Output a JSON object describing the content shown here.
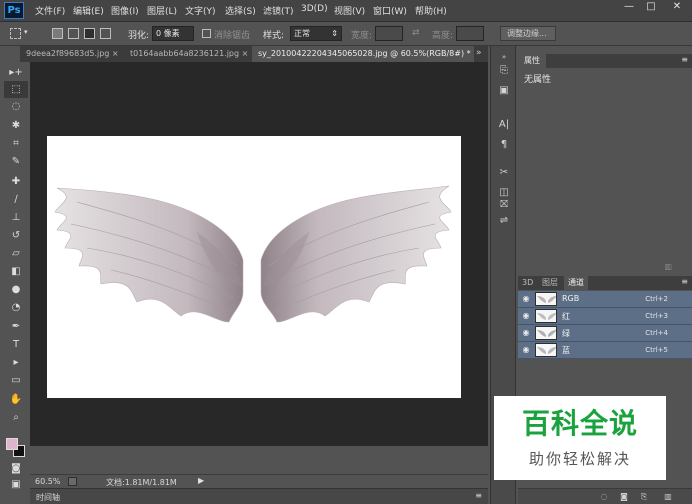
{
  "app": {
    "logo": "Ps"
  },
  "menu": [
    "文件(F)",
    "编辑(E)",
    "图像(I)",
    "图层(L)",
    "文字(Y)",
    "选择(S)",
    "滤镜(T)",
    "3D(D)",
    "视图(V)",
    "窗口(W)",
    "帮助(H)"
  ],
  "window_controls": {
    "minimize": "—",
    "maximize": "□",
    "close": "✕"
  },
  "options": {
    "feather_label": "羽化:",
    "feather_value": "0 像素",
    "antialias_label": "消除锯齿",
    "style_label": "样式:",
    "style_value": "正常",
    "width_label": "宽度:",
    "height_label": "高度:",
    "refine_button": "调整边缘..."
  },
  "tabs": [
    {
      "label": "9deea2f89683d5.jpg",
      "close": "×"
    },
    {
      "label": "t0164aabb64a8236121.jpg",
      "close": "×"
    },
    {
      "label": "sy_20100422204345065028.jpg @ 60.5%(RGB/8#) *",
      "close": "×"
    }
  ],
  "tab_overflow": "»",
  "tools": [
    "move",
    "marquee",
    "lasso",
    "magic-wand",
    "crop",
    "eyedropper",
    "healing",
    "brush",
    "stamp",
    "history-brush",
    "eraser",
    "gradient",
    "blur",
    "dodge",
    "pen",
    "type",
    "path-select",
    "shape",
    "hand",
    "zoom"
  ],
  "tool_glyphs": [
    "▸+",
    "⬚",
    "◌",
    "✱",
    "⌗",
    "✎",
    "✚",
    "∕",
    "⊥",
    "↺",
    "▱",
    "◧",
    "●",
    "◔",
    "✒",
    "T",
    "▸",
    "▭",
    "✋",
    "⌕"
  ],
  "colors": {
    "foreground": "#e0b4cf",
    "background": "#111111",
    "selected_row": "#5d6f87"
  },
  "status": {
    "zoom": "60.5%",
    "doc": "文档:1.81M/1.81M"
  },
  "timeline": {
    "label": "时间轴"
  },
  "properties": {
    "tab": "属性",
    "body": "无属性"
  },
  "panel2": {
    "tabs": [
      "3D",
      "图层",
      "通道"
    ],
    "active_tab": "通道",
    "channels": [
      {
        "name": "RGB",
        "shortcut": "Ctrl+2"
      },
      {
        "name": "红",
        "shortcut": "Ctrl+3"
      },
      {
        "name": "绿",
        "shortcut": "Ctrl+4"
      },
      {
        "name": "蓝",
        "shortcut": "Ctrl+5"
      }
    ]
  },
  "watermark": {
    "title": "百科全说",
    "subtitle": "助你轻松解决"
  }
}
